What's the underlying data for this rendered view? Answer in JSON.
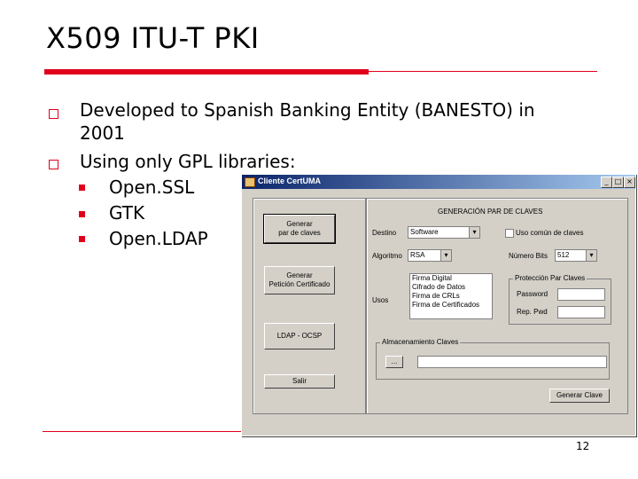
{
  "slide": {
    "title": "X509 ITU-T PKI",
    "bullets": [
      "Developed to Spanish Banking Entity (BANESTO) in",
      "2001",
      "Using only GPL libraries:"
    ],
    "sub_bullets": [
      "Open.SSL",
      "GTK",
      "Open.LDAP"
    ],
    "page_number": "12",
    "accent_color": "#e0001b"
  },
  "window": {
    "title": "Cliente CertUMA",
    "controls": {
      "minimize": "_",
      "maximize": "□",
      "close": "×"
    },
    "left_buttons": [
      "Generar",
      "par de claves",
      "Generar",
      "Petición Certificado",
      "LDAP - OCSP",
      "Salir"
    ],
    "section_title": "GENERACIÓN PAR DE CLAVES",
    "destino_label": "Destino",
    "destino_value": "Software",
    "algoritmo_label": "Algoritmo",
    "algoritmo_value": "RSA",
    "usos_label": "Usos",
    "usos_options": [
      "Firma Digital",
      "Cifrado de Datos",
      "Firma de CRLs",
      "Firma de Certificados"
    ],
    "uso_comun_label": "Uso común de claves",
    "numero_bits_label": "Número Bits",
    "numero_bits_value": "512",
    "proteccion_label": "Protección Par Claves",
    "password_label": "Password",
    "repassword_label": "Rep. Pwd",
    "almacenamiento_label": "Almacenamiento Claves",
    "browse_label": "...",
    "generar_clave_label": "Generar Clave"
  }
}
